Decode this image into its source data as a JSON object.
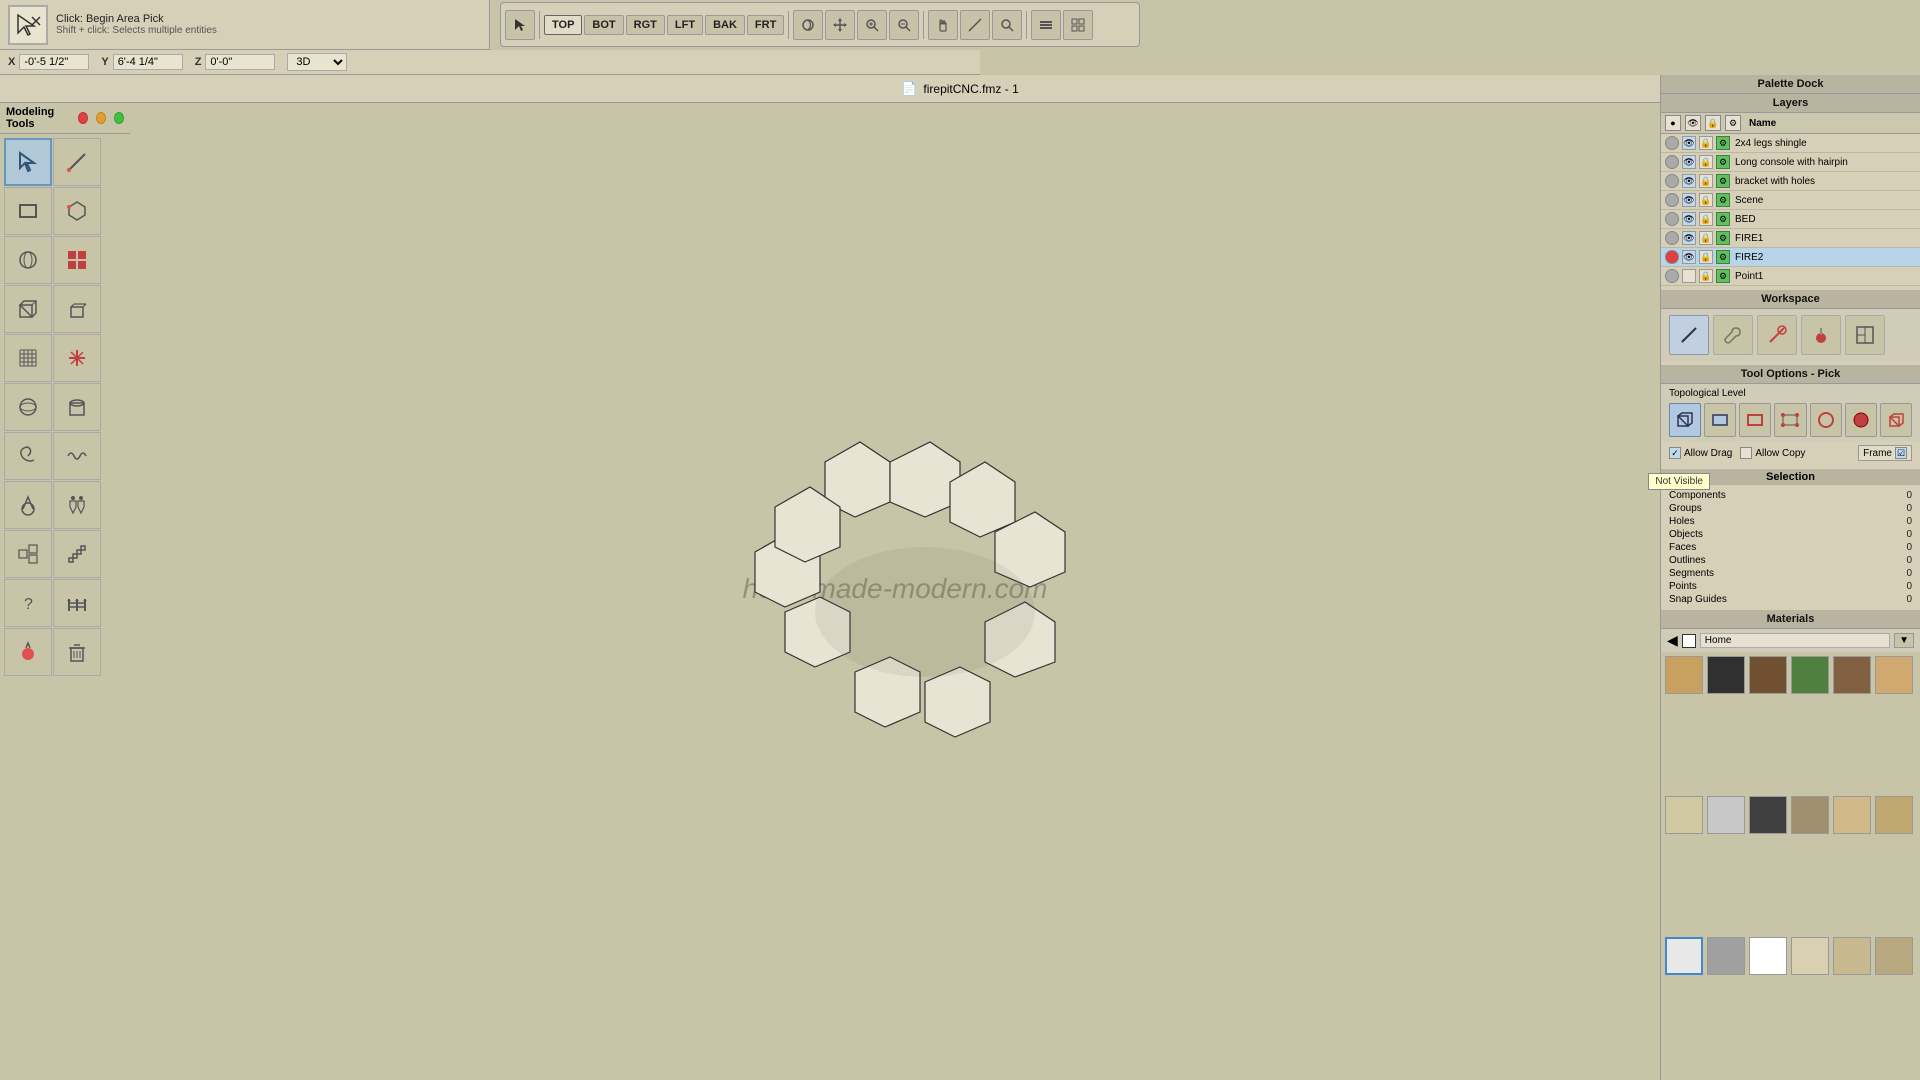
{
  "toolbar": {
    "tool_name": "Click: Begin Area Pick",
    "tool_hint": "Shift + click: Selects multiple entities",
    "view_buttons": [
      "TOP",
      "BOT",
      "RGT",
      "LFT",
      "BAK",
      "FRT"
    ],
    "active_view": "TOP"
  },
  "coords": {
    "x_label": "X",
    "x_value": "-0'-5 1/2\"",
    "y_label": "Y",
    "y_value": "6'-4 1/4\"",
    "z_label": "Z",
    "z_value": "0'-0\"",
    "view_mode": "3D"
  },
  "title": {
    "text": "firepitCNC.fmz - 1"
  },
  "modeling_tools": {
    "label": "Modeling Tools"
  },
  "canvas": {
    "watermark": "homemade-modern.com"
  },
  "palette": {
    "title": "Palette Dock"
  },
  "layers": {
    "title": "Layers",
    "columns": [
      "",
      "",
      "",
      "Name"
    ],
    "items": [
      {
        "name": "2x4 legs shingle",
        "vis": "gray",
        "eye": true,
        "lock": false,
        "gear": true,
        "active": false
      },
      {
        "name": "Long console with hairpin",
        "vis": "gray",
        "eye": true,
        "lock": false,
        "gear": true,
        "active": false
      },
      {
        "name": "bracket with holes",
        "vis": "gray",
        "eye": true,
        "lock": false,
        "gear": true,
        "active": false
      },
      {
        "name": "Scene",
        "vis": "gray",
        "eye": true,
        "lock": false,
        "gear": true,
        "active": false
      },
      {
        "name": "BED",
        "vis": "gray",
        "eye": true,
        "lock": false,
        "gear": true,
        "active": false
      },
      {
        "name": "FIRE1",
        "vis": "gray",
        "eye": true,
        "lock": false,
        "gear": true,
        "active": false
      },
      {
        "name": "FIRE2",
        "vis": "red",
        "eye": true,
        "lock": false,
        "gear": true,
        "active": true
      },
      {
        "name": "Point1",
        "vis": "gray",
        "eye": false,
        "lock": false,
        "gear": true,
        "active": false
      }
    ],
    "not_visible_tooltip": "Not Visible"
  },
  "workspace": {
    "title": "Workspace",
    "icons": [
      "✏️",
      "🔧",
      "📌",
      "🎨",
      "📋"
    ]
  },
  "tool_options": {
    "title": "Tool Options - Pick",
    "topological_level_label": "Topological Level",
    "topo_icons": [
      "object",
      "face",
      "edge",
      "vertex",
      "edge2",
      "face2",
      "solid"
    ],
    "allow_drag_label": "Allow Drag",
    "allow_drag_checked": true,
    "allow_copy_label": "Allow Copy",
    "allow_copy_checked": false,
    "frame_label": "Frame",
    "frame_checked": true
  },
  "selection": {
    "title": "Selection",
    "rows": [
      {
        "label": "Components",
        "value": "0"
      },
      {
        "label": "Groups",
        "value": "0"
      },
      {
        "label": "Holes",
        "value": "0"
      },
      {
        "label": "Objects",
        "value": "0"
      },
      {
        "label": "Faces",
        "value": "0"
      },
      {
        "label": "Outlines",
        "value": "0"
      },
      {
        "label": "Segments",
        "value": "0"
      },
      {
        "label": "Points",
        "value": "0"
      },
      {
        "label": "Snap Guides",
        "value": "0"
      }
    ]
  },
  "materials": {
    "title": "Materials",
    "current_material": "Home",
    "nav_left": "◀",
    "nav_right": "▶",
    "colors": [
      "#c8a060",
      "#303030",
      "#705030",
      "#508040",
      "#806040",
      "#d0a870",
      "#d0c8a0",
      "#c8c8c8",
      "#404040",
      "#a09070",
      "#d0b888",
      "#c0a870",
      "#e8e8e8",
      "#a0a0a0",
      "#ffffff",
      "#d8d0b0",
      "#c8b890",
      "#b8a880"
    ],
    "selected_material_index": 12
  }
}
